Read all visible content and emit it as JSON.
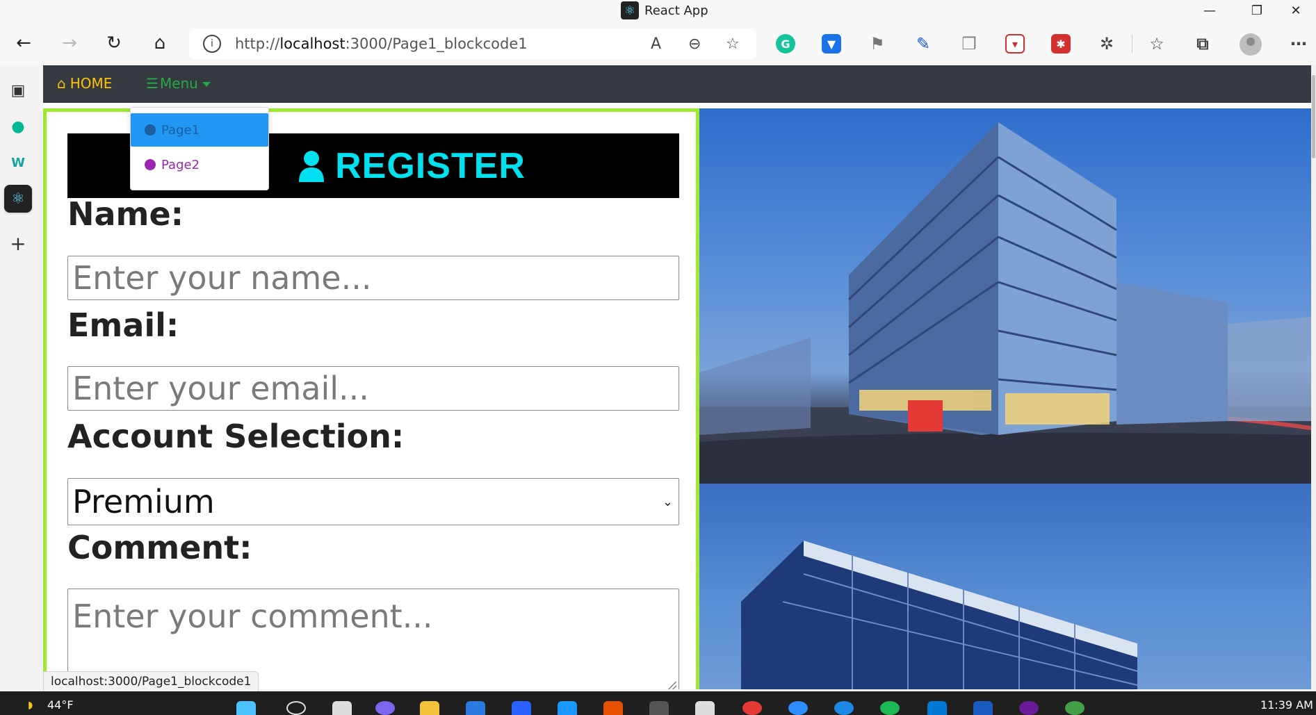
{
  "browser": {
    "tab_title": "React App",
    "url_prefix": "http://",
    "url_host": "localhost",
    "url_rest": ":3000/Page1_blockcode1",
    "status_url": "localhost:3000/Page1_blockcode1"
  },
  "app": {
    "nav": {
      "home_label": "HOME",
      "menu_label": "Menu"
    },
    "dropdown": [
      {
        "label": "Page1",
        "active": true
      },
      {
        "label": "Page2",
        "active": false
      }
    ],
    "form": {
      "title": "REGISTER",
      "name_label": "Name:",
      "name_placeholder": "Enter your name...",
      "email_label": "Email:",
      "email_placeholder": "Enter your email...",
      "account_label": "Account Selection:",
      "account_value": "Premium",
      "comment_label": "Comment:",
      "comment_placeholder": "Enter your comment..."
    },
    "accent_colors": {
      "border": "#9eea2f",
      "title": "#00e0ef",
      "navbar": "#343a40",
      "home": "#ffc107",
      "menu": "#28a745"
    }
  },
  "taskbar": {
    "weather": "44°F",
    "time": "11:39 AM"
  }
}
